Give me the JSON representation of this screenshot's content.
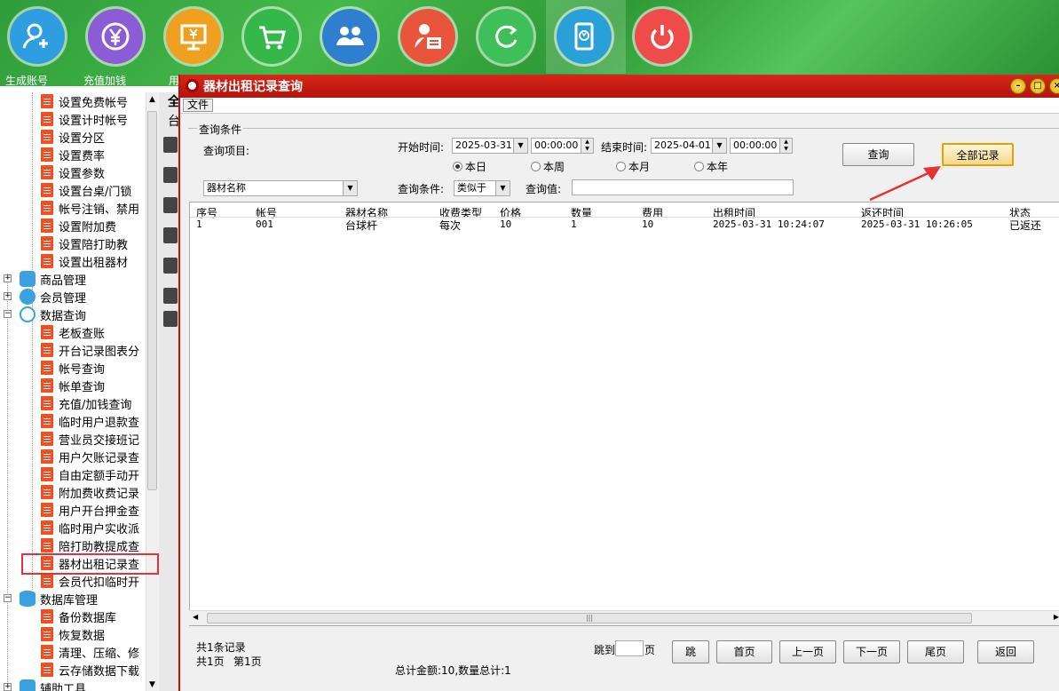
{
  "toolbar": {
    "items": [
      {
        "label": "生成账号",
        "icon": "add-user-icon",
        "color": "#2f9ee0"
      },
      {
        "label": "充值加钱",
        "icon": "yen-icon",
        "color": "#8b5cd6"
      },
      {
        "label": "用",
        "icon": "monitor-icon",
        "color": "#f0a020"
      },
      {
        "label": "",
        "icon": "cart-icon",
        "color": "#34b84a"
      },
      {
        "label": "",
        "icon": "users-icon",
        "color": "#2f7fd0"
      },
      {
        "label": "",
        "icon": "user-card-icon",
        "color": "#e8543c"
      },
      {
        "label": "",
        "icon": "refresh-icon",
        "color": "#3fbf5a"
      },
      {
        "label": "",
        "icon": "phone-pay-icon",
        "color": "#2aa0d8"
      },
      {
        "label": "",
        "icon": "power-icon",
        "color": "#ef4b4b"
      }
    ]
  },
  "sidebar": {
    "settings_items": [
      "设置免费帐号",
      "设置计时帐号",
      "设置分区",
      "设置费率",
      "设置参数",
      "设置台桌/门锁",
      "帐号注销、禁用",
      "设置附加费",
      "设置陪打助教",
      "设置出租器材"
    ],
    "categories": {
      "goods": "商品管理",
      "members": "会员管理",
      "query": "数据查询",
      "db": "数据库管理",
      "tools": "辅助工具"
    },
    "query_items": [
      "老板查账",
      "开台记录图表分",
      "帐号查询",
      "帐单查询",
      "充值/加钱查询",
      "临时用户退款查",
      "营业员交接班记",
      "用户欠账记录查",
      "自由定额手动开",
      "附加费收费记录",
      "用户开台押金查",
      "临时用户实收派",
      "陪打助教提成查",
      "器材出租记录查",
      "会员代扣临时开"
    ],
    "db_items": [
      "备份数据库",
      "恢复数据",
      "清理、压缩、修",
      "云存储数据下载"
    ]
  },
  "midpane": {
    "char1": "全",
    "char2": "台"
  },
  "window": {
    "title": "器材出租记录查询",
    "menu_file": "文件",
    "conditions_group": "查询条件",
    "query_item_label": "查询项目:",
    "start_label": "开始时间:",
    "start_date": "2025-03-31",
    "start_time": "00:00:00",
    "end_label": "结束时间:",
    "end_date": "2025-04-01",
    "end_time": "00:00:00",
    "radio_today": "本日",
    "radio_week": "本周",
    "radio_month": "本月",
    "radio_year": "本年",
    "query_button": "查询",
    "all_records_button": "全部记录",
    "item_select": "器材名称",
    "condition_label": "查询条件:",
    "condition_select": "类似于",
    "value_label": "查询值:",
    "value_input": ""
  },
  "table": {
    "headers": [
      "序号",
      "帐号",
      "器材名称",
      "收费类型",
      "价格",
      "数量",
      "费用",
      "出租时间",
      "返还时间",
      "状态"
    ],
    "rows": [
      [
        "1",
        "001",
        "台球杆",
        "每次",
        "10",
        "1",
        "10",
        "2025-03-31 10:24:07",
        "2025-03-31 10:26:05",
        "已返还"
      ]
    ]
  },
  "footer": {
    "total_records": "共1条记录",
    "pages": "共1页",
    "current_page": "第1页",
    "totals": "总计金额:10,数量总计:1",
    "jump_label": "跳到",
    "page_unit": "页",
    "jump_btn": "跳",
    "first_btn": "首页",
    "prev_btn": "上一页",
    "next_btn": "下一页",
    "last_btn": "尾页",
    "back_btn": "返回"
  }
}
